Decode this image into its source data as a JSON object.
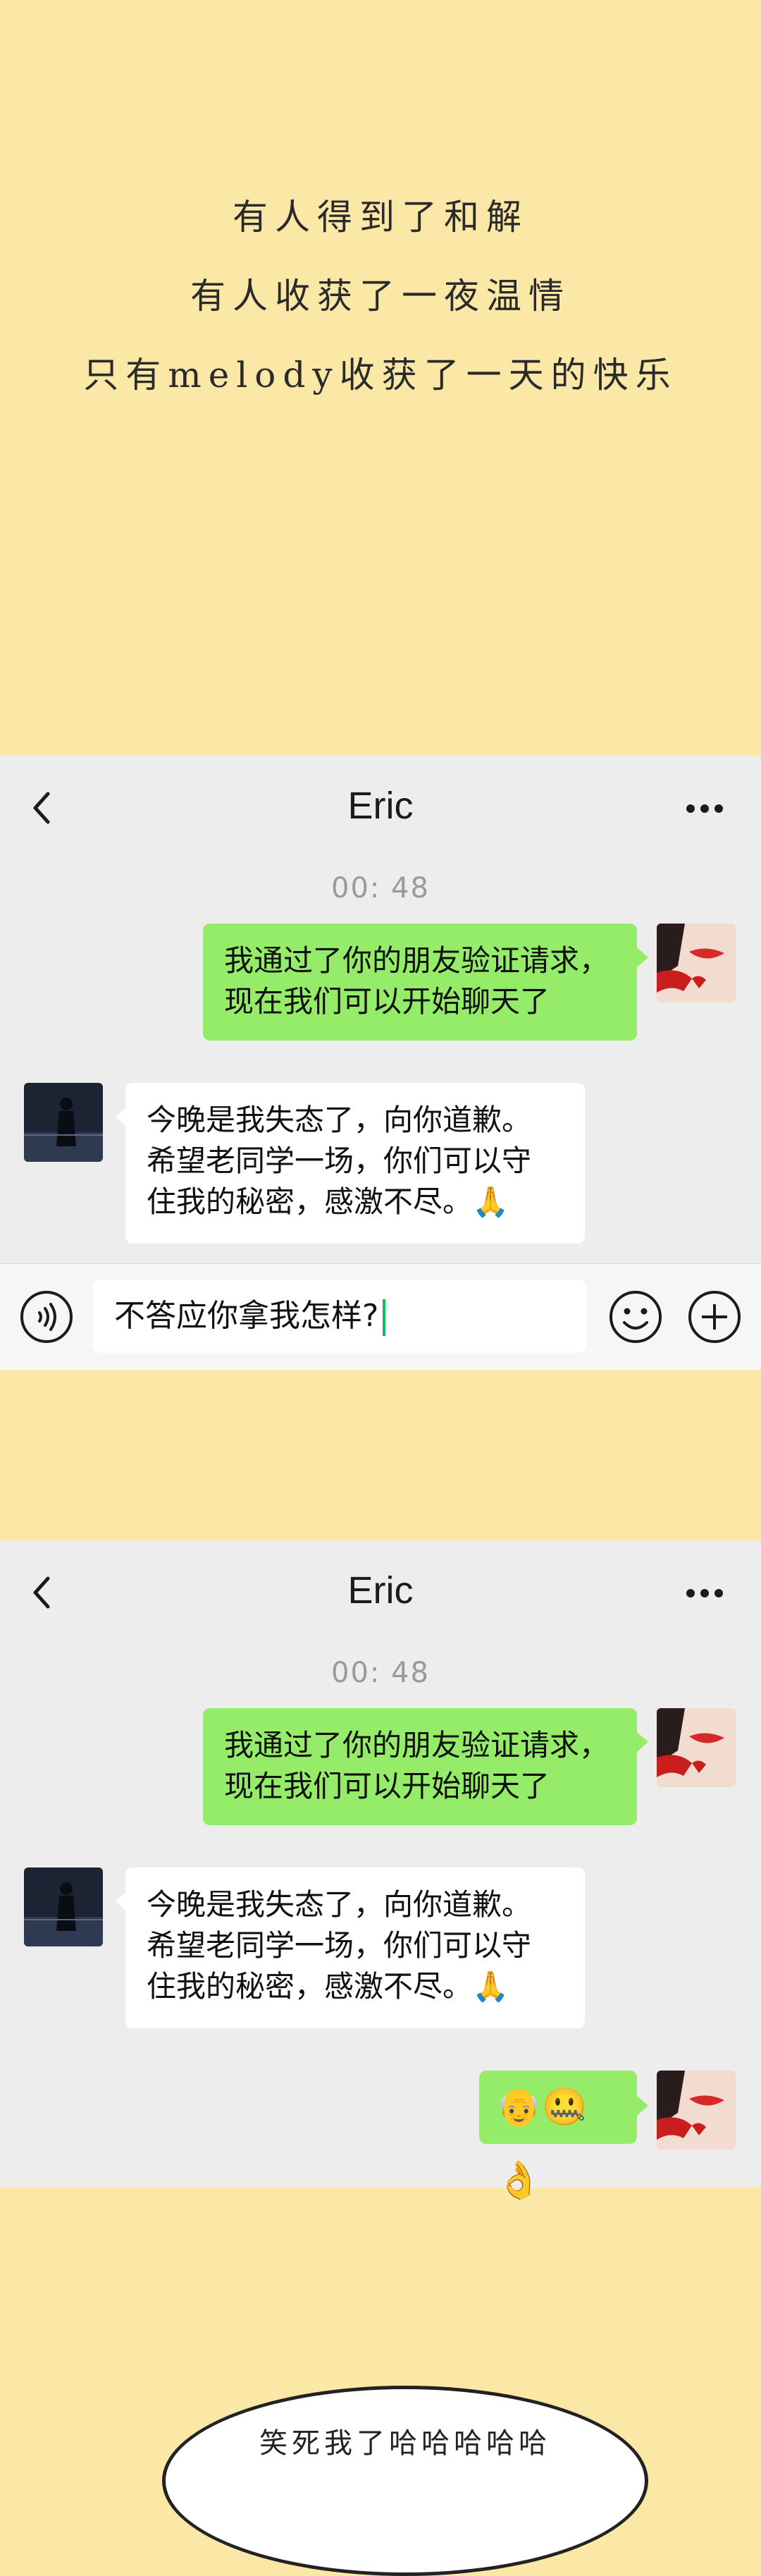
{
  "intro": {
    "lines": [
      "有人得到了和解",
      "有人收获了一夜温情",
      "只有melody收获了一天的快乐"
    ]
  },
  "chat_top": {
    "title": "Eric",
    "time": "00: 48",
    "messages": [
      {
        "side": "right",
        "text": "我通过了你的朋友验证请求，\n现在我们可以开始聊天了"
      },
      {
        "side": "left",
        "text": "今晚是我失态了，向你道歉。\n希望老同学一场，你们可以守\n住我的秘密，感激不尽。🙏"
      }
    ],
    "input_value": "不答应你拿我怎样?"
  },
  "chat_bottom": {
    "title": "Eric",
    "time": "00: 48",
    "messages": [
      {
        "side": "right",
        "text": "我通过了你的朋友验证请求，\n现在我们可以开始聊天了"
      },
      {
        "side": "left",
        "text": "今晚是我失态了，向你道歉。\n希望老同学一场，你们可以守\n住我的秘密，感激不尽。🙏"
      },
      {
        "side": "right",
        "text": "👴🤐👌"
      }
    ]
  },
  "thought": {
    "text": "笑死我了哈哈哈哈哈"
  },
  "colors": {
    "background": "#FCE8A6",
    "panel": "#EDEDED",
    "green_bubble": "#95EC69",
    "caret": "#07C160"
  }
}
